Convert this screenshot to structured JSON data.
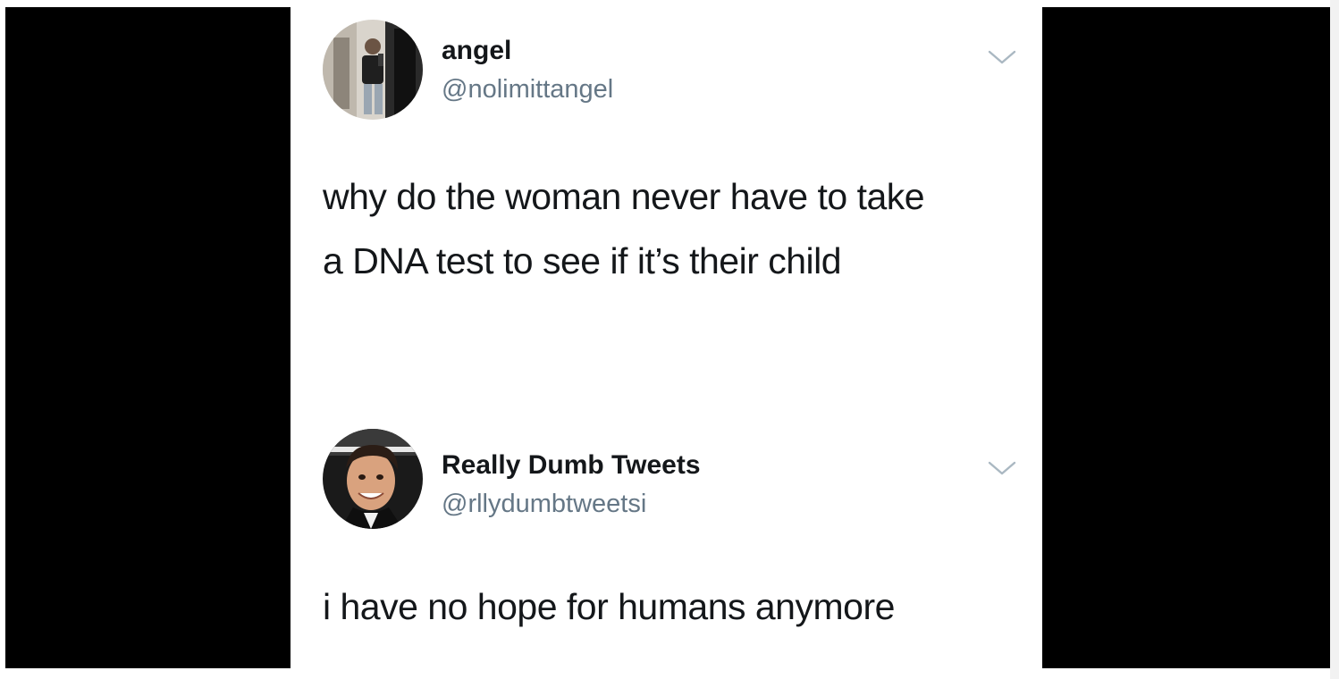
{
  "tweets": [
    {
      "display_name": "angel",
      "handle": "@nolimittangel",
      "text_lines": [
        "why do the woman never have to take",
        "a DNA test to see if it’s their child"
      ],
      "avatar_icon": "person-photo-icon",
      "menu_icon": "chevron-down-icon"
    },
    {
      "display_name": "Really Dumb Tweets",
      "handle": "@rllydumbtweetsi",
      "text_lines": [
        "i have no hope for humans anymore"
      ],
      "avatar_icon": "smiling-face-photo-icon",
      "menu_icon": "chevron-down-icon"
    }
  ],
  "colors": {
    "background": "#000000",
    "card": "#ffffff",
    "name": "#14171a",
    "handle": "#657786",
    "chevron": "#aab8c2"
  }
}
